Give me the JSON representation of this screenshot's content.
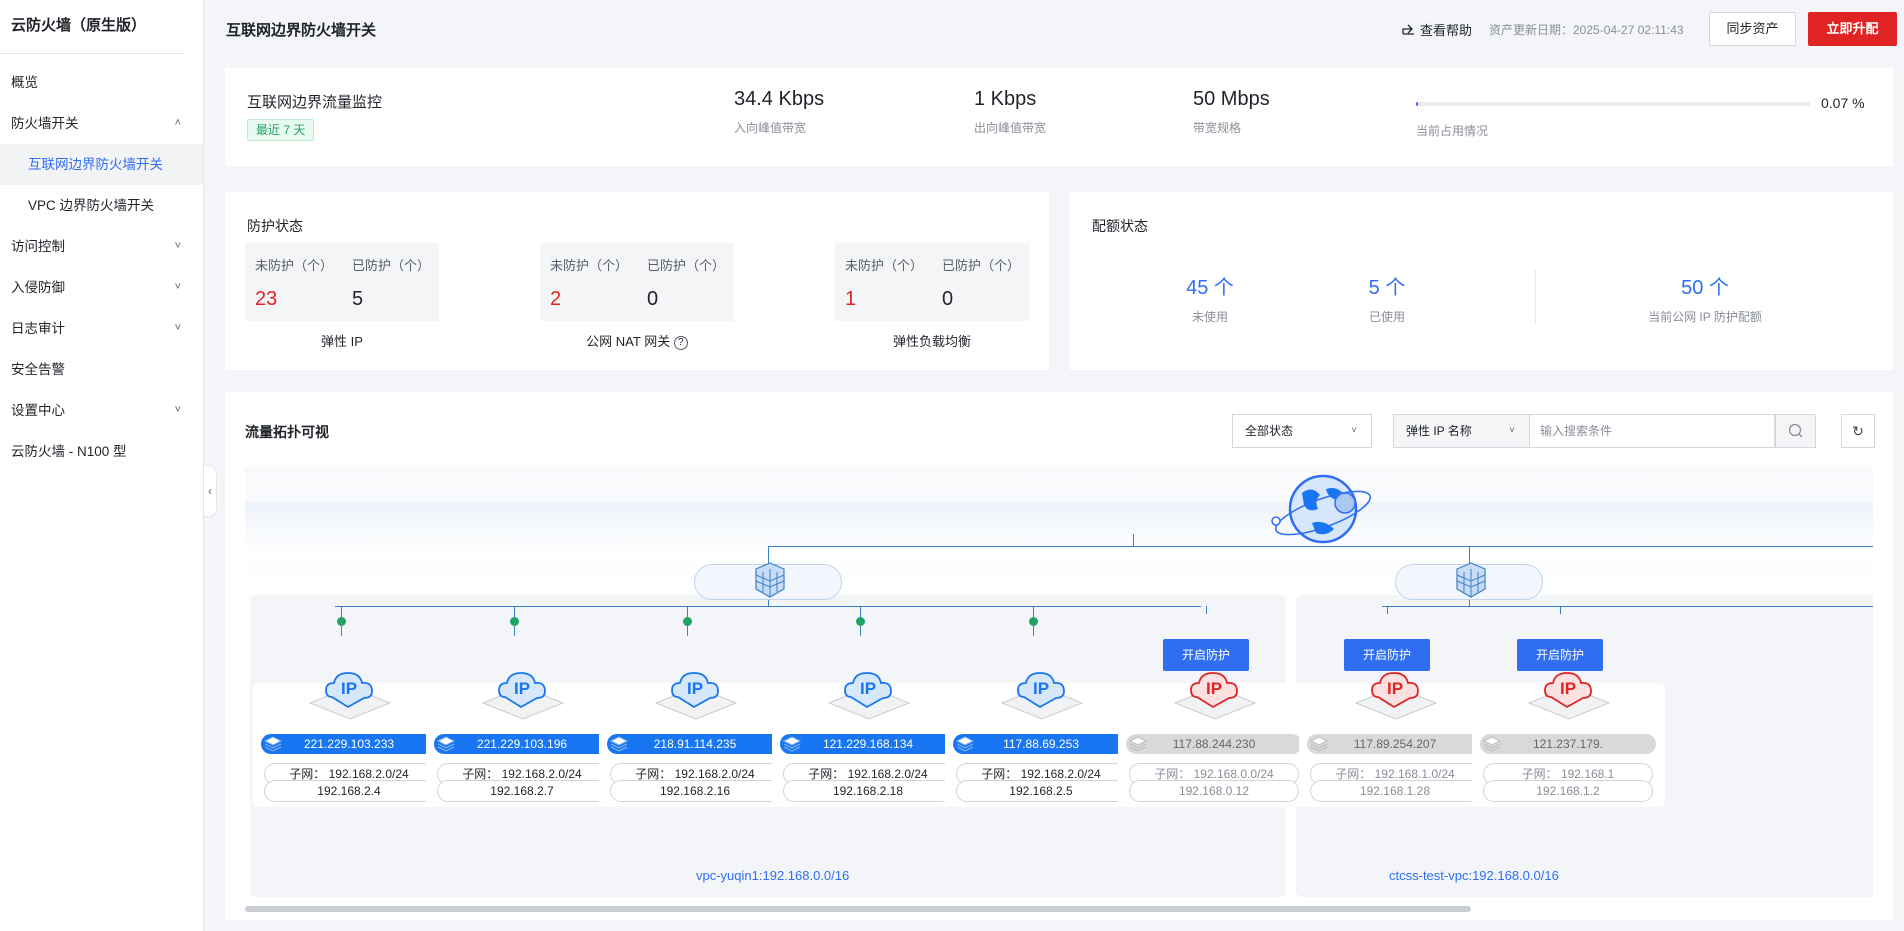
{
  "sidebar": {
    "title": "云防火墙（原生版）",
    "items": [
      {
        "label": "概览"
      },
      {
        "label": "防火墙开关"
      },
      {
        "label": "互联网边界防火墙开关"
      },
      {
        "label": "VPC 边界防火墙开关"
      },
      {
        "label": "访问控制"
      },
      {
        "label": "入侵防御"
      },
      {
        "label": "日志审计"
      },
      {
        "label": "安全告警"
      },
      {
        "label": "设置中心"
      },
      {
        "label": "云防火墙 - N100 型"
      }
    ]
  },
  "header": {
    "title": "互联网边界防火墙开关",
    "help": "查看帮助",
    "asset_date": "资产更新日期：2025-04-27 02:11:43",
    "sync_button": "同步资产",
    "upgrade_button": "立即升配"
  },
  "traffic": {
    "title": "互联网边界流量监控",
    "range_tag": "最近 7 天",
    "inbound_value": "34.4 Kbps",
    "inbound_label": "入向峰值带宽",
    "outbound_value": "1 Kbps",
    "outbound_label": "出向峰值带宽",
    "bandwidth_value": "50 Mbps",
    "bandwidth_label": "带宽规格",
    "usage_percent": "0.07 %",
    "usage_fraction": 0.0007,
    "usage_label": "当前占用情况"
  },
  "protection": {
    "title": "防护状态",
    "groups": [
      {
        "unprotected_label": "未防护（个）",
        "protected_label": "已防护（个）",
        "unprotected": "23",
        "protected": "5",
        "caption": "弹性 IP"
      },
      {
        "unprotected_label": "未防护（个）",
        "protected_label": "已防护（个）",
        "unprotected": "2",
        "protected": "0",
        "caption": "公网 NAT 网关"
      },
      {
        "unprotected_label": "未防护（个）",
        "protected_label": "已防护（个）",
        "unprotected": "1",
        "protected": "0",
        "caption": "弹性负载均衡"
      }
    ]
  },
  "quota": {
    "title": "配额状态",
    "unused_value": "45 个",
    "unused_label": "未使用",
    "used_value": "5 个",
    "used_label": "已使用",
    "total_value": "50 个",
    "total_label": "当前公网 IP 防护配额"
  },
  "topology": {
    "title": "流量拓扑可视",
    "status_filter": "全部状态",
    "search_type": "弹性 IP 名称",
    "search_placeholder": "输入搜索条件",
    "enable_label": "开启防护",
    "vpcs": [
      {
        "label": "vpc-yuqin1:192.168.0.0/16"
      },
      {
        "label": "ctcss-test-vpc:192.168.0.0/16"
      }
    ],
    "ips": [
      {
        "ip": "221.229.103.233",
        "subnet": "子网：  192.168.2.0/24",
        "private": "192.168.2.4",
        "protected": true
      },
      {
        "ip": "221.229.103.196",
        "subnet": "子网：  192.168.2.0/24",
        "private": "192.168.2.7",
        "protected": true
      },
      {
        "ip": "218.91.114.235",
        "subnet": "子网：  192.168.2.0/24",
        "private": "192.168.2.16",
        "protected": true
      },
      {
        "ip": "121.229.168.134",
        "subnet": "子网：  192.168.2.0/24",
        "private": "192.168.2.18",
        "protected": true
      },
      {
        "ip": "117.88.69.253",
        "subnet": "子网：  192.168.2.0/24",
        "private": "192.168.2.5",
        "protected": true
      },
      {
        "ip": "117.88.244.230",
        "subnet": "子网：  192.168.0.0/24",
        "private": "192.168.0.12",
        "protected": false
      },
      {
        "ip": "117.89.254.207",
        "subnet": "子网：  192.168.1.0/24",
        "private": "192.168.1.28",
        "protected": false
      },
      {
        "ip": "121.237.179.",
        "subnet": "子网：  192.168.1",
        "private": "192.168.1.2",
        "protected": false
      }
    ]
  },
  "colors": {
    "accent": "#2f6ef3",
    "danger": "#e02424",
    "success": "#21a366",
    "ip_protected": "#1876f2",
    "ip_unprotected": "#d9d9d9"
  }
}
